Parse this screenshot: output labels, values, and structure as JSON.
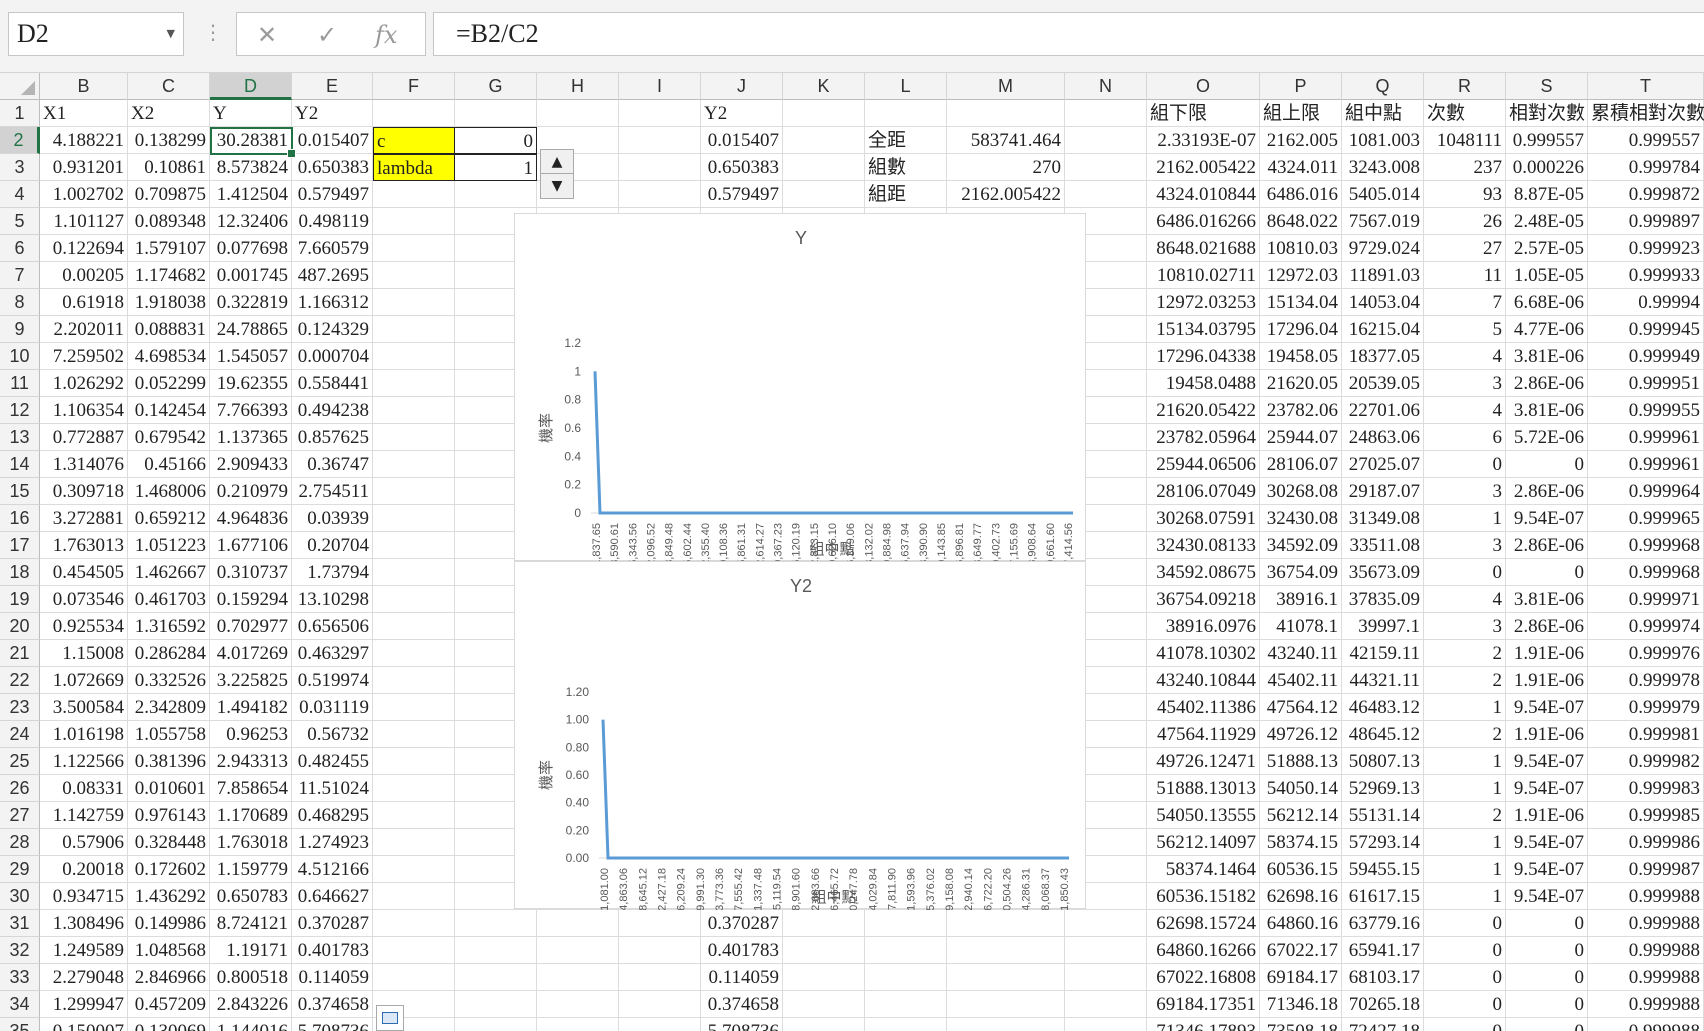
{
  "name_box": "D2",
  "formula": "=B2/C2",
  "icons": {
    "cancel": "✕",
    "enter": "✓",
    "fx": "fx"
  },
  "columns": [
    "B",
    "C",
    "D",
    "E",
    "F",
    "G",
    "H",
    "I",
    "J",
    "K",
    "L",
    "M",
    "N",
    "O",
    "P",
    "Q",
    "R",
    "S",
    "T"
  ],
  "selected_column": "D",
  "rows": [
    1,
    2,
    3,
    4,
    5,
    6,
    7,
    8,
    9,
    10,
    11,
    12,
    13,
    14,
    15,
    16,
    17,
    18,
    19,
    20,
    21,
    22,
    23,
    24,
    25,
    26,
    27,
    28,
    29,
    30,
    31,
    32,
    33,
    34,
    35
  ],
  "selected_row": 2,
  "headers": {
    "B": "X1",
    "C": "X2",
    "D": "Y",
    "E": "Y2",
    "J": "Y2",
    "O": "組下限",
    "P": "組上限",
    "Q": "組中點",
    "R": "次數",
    "S": "相對次數",
    "T": "累積相對次數"
  },
  "colB": [
    "4.188221",
    "0.931201",
    "1.002702",
    "1.101127",
    "0.122694",
    "0.00205",
    "0.61918",
    "2.202011",
    "7.259502",
    "1.026292",
    "1.106354",
    "0.772887",
    "1.314076",
    "0.309718",
    "3.272881",
    "1.763013",
    "0.454505",
    "0.073546",
    "0.925534",
    "1.15008",
    "1.072669",
    "3.500584",
    "1.016198",
    "1.122566",
    "0.08331",
    "1.142759",
    "0.57906",
    "0.20018",
    "0.934715",
    "1.308496",
    "1.249589",
    "2.279048",
    "1.299947",
    "0.150007"
  ],
  "colC": [
    "0.138299",
    "0.10861",
    "0.709875",
    "0.089348",
    "1.579107",
    "1.174682",
    "1.918038",
    "0.088831",
    "4.698534",
    "0.052299",
    "0.142454",
    "0.679542",
    "0.45166",
    "1.468006",
    "0.659212",
    "1.051223",
    "1.462667",
    "0.461703",
    "1.316592",
    "0.286284",
    "0.332526",
    "2.342809",
    "1.055758",
    "0.381396",
    "0.010601",
    "0.976143",
    "0.328448",
    "0.172602",
    "1.436292",
    "0.149986",
    "1.048568",
    "2.846966",
    "0.457209",
    "0.130069"
  ],
  "colD": [
    "30.28381",
    "8.573824",
    "1.412504",
    "12.32406",
    "0.077698",
    "0.001745",
    "0.322819",
    "24.78865",
    "1.545057",
    "19.62355",
    "7.766393",
    "1.137365",
    "2.909433",
    "0.210979",
    "4.964836",
    "1.677106",
    "0.310737",
    "0.159294",
    "0.702977",
    "4.017269",
    "3.225825",
    "1.494182",
    "0.96253",
    "2.943313",
    "7.858654",
    "1.170689",
    "1.763018",
    "1.159779",
    "0.650783",
    "8.724121",
    "1.19171",
    "0.800518",
    "2.843226",
    "1.144016"
  ],
  "colE": [
    "0.015407",
    "0.650383",
    "0.579497",
    "0.498119",
    "7.660579",
    "487.2695",
    "1.166312",
    "0.124329",
    "0.000704",
    "0.558441",
    "0.494238",
    "0.857625",
    "0.36747",
    "2.754511",
    "0.03939",
    "0.20704",
    "1.73794",
    "13.10298",
    "0.656506",
    "0.463297",
    "0.519974",
    "0.031119",
    "0.56732",
    "0.482455",
    "11.51024",
    "0.468295",
    "1.274923",
    "4.512166",
    "0.646627",
    "0.370287",
    "0.401783",
    "0.114059",
    "0.374658",
    "5.708736"
  ],
  "params": {
    "c_label": "c",
    "c_value": "0",
    "lambda_label": "lambda",
    "lambda_value": "1"
  },
  "colJ": {
    "2": "0.015407",
    "3": "0.650383",
    "4": "0.579497",
    "31": "0.370287",
    "32": "0.401783",
    "33": "0.114059",
    "34": "0.374658",
    "35": "5.708736"
  },
  "stats": [
    {
      "label": "全距",
      "value": "583741.464"
    },
    {
      "label": "組數",
      "value": "270"
    },
    {
      "label": "組距",
      "value": "2162.005422"
    }
  ],
  "colO": [
    "2.33193E-07",
    "2162.005422",
    "4324.010844",
    "6486.016266",
    "8648.021688",
    "10810.02711",
    "12972.03253",
    "15134.03795",
    "17296.04338",
    "19458.0488",
    "21620.05422",
    "23782.05964",
    "25944.06506",
    "28106.07049",
    "30268.07591",
    "32430.08133",
    "34592.08675",
    "36754.09218",
    "38916.0976",
    "41078.10302",
    "43240.10844",
    "45402.11386",
    "47564.11929",
    "49726.12471",
    "51888.13013",
    "54050.13555",
    "56212.14097",
    "58374.1464",
    "60536.15182",
    "62698.15724",
    "64860.16266",
    "67022.16808",
    "69184.17351",
    "71346.17893"
  ],
  "colP": [
    "2162.005",
    "4324.011",
    "6486.016",
    "8648.022",
    "10810.03",
    "12972.03",
    "15134.04",
    "17296.04",
    "19458.05",
    "21620.05",
    "23782.06",
    "25944.07",
    "28106.07",
    "30268.08",
    "32430.08",
    "34592.09",
    "36754.09",
    "38916.1",
    "41078.1",
    "43240.11",
    "45402.11",
    "47564.12",
    "49726.12",
    "51888.13",
    "54050.14",
    "56212.14",
    "58374.15",
    "60536.15",
    "62698.16",
    "64860.16",
    "67022.17",
    "69184.17",
    "71346.18",
    "73508.18"
  ],
  "colQ": [
    "1081.003",
    "3243.008",
    "5405.014",
    "7567.019",
    "9729.024",
    "11891.03",
    "14053.04",
    "16215.04",
    "18377.05",
    "20539.05",
    "22701.06",
    "24863.06",
    "27025.07",
    "29187.07",
    "31349.08",
    "33511.08",
    "35673.09",
    "37835.09",
    "39997.1",
    "42159.11",
    "44321.11",
    "46483.12",
    "48645.12",
    "50807.13",
    "52969.13",
    "55131.14",
    "57293.14",
    "59455.15",
    "61617.15",
    "63779.16",
    "65941.17",
    "68103.17",
    "70265.18",
    "72427.18"
  ],
  "colR": [
    "1048111",
    "237",
    "93",
    "26",
    "27",
    "11",
    "7",
    "5",
    "4",
    "3",
    "4",
    "6",
    "0",
    "3",
    "1",
    "3",
    "0",
    "4",
    "3",
    "2",
    "2",
    "1",
    "2",
    "1",
    "1",
    "2",
    "1",
    "1",
    "1",
    "0",
    "0",
    "0",
    "0",
    "0"
  ],
  "colS": [
    "0.999557",
    "0.000226",
    "8.87E-05",
    "2.48E-05",
    "2.57E-05",
    "1.05E-05",
    "6.68E-06",
    "4.77E-06",
    "3.81E-06",
    "2.86E-06",
    "3.81E-06",
    "5.72E-06",
    "0",
    "2.86E-06",
    "9.54E-07",
    "2.86E-06",
    "0",
    "3.81E-06",
    "2.86E-06",
    "1.91E-06",
    "1.91E-06",
    "9.54E-07",
    "1.91E-06",
    "9.54E-07",
    "9.54E-07",
    "1.91E-06",
    "9.54E-07",
    "9.54E-07",
    "9.54E-07",
    "0",
    "0",
    "0",
    "0",
    "0"
  ],
  "colT": [
    "0.999557",
    "0.999784",
    "0.999872",
    "0.999897",
    "0.999923",
    "0.999933",
    "0.99994",
    "0.999945",
    "0.999949",
    "0.999951",
    "0.999955",
    "0.999961",
    "0.999961",
    "0.999964",
    "0.999965",
    "0.999968",
    "0.999968",
    "0.999971",
    "0.999974",
    "0.999976",
    "0.999978",
    "0.999979",
    "0.999981",
    "0.999982",
    "0.999983",
    "0.999985",
    "0.999986",
    "0.999987",
    "0.999988",
    "0.999988",
    "0.999988",
    "0.999988",
    "0.999988",
    "0.999988"
  ],
  "chart_data": [
    {
      "type": "line",
      "title": "Y",
      "xlabel": "組中點",
      "ylabel": "機率",
      "yticks": [
        "0",
        "0.2",
        "0.4",
        "0.6",
        "0.8",
        "1",
        "1.2"
      ],
      "ylim": [
        0,
        1.2
      ],
      "categories": [
        "1,837.65",
        "38,590.61",
        "75,343.56",
        "112,096.52",
        "148,849.48",
        "185,602.44",
        "222,355.40",
        "259,108.36",
        "295,861.31",
        "332,614.27",
        "369,367.23",
        "406,120.19",
        "442,873.15",
        "479,626.10",
        "516,379.06",
        "553,132.02",
        "589,884.98",
        "626,637.94",
        "663,390.90",
        "700,143.85",
        "736,896.81",
        "773,649.77",
        "810,402.73",
        "847,155.69",
        "883,908.64",
        "920,661.60",
        "957,414.56"
      ],
      "series": [
        {
          "values": [
            1,
            0,
            0,
            0,
            0,
            0,
            0,
            0,
            0,
            0,
            0,
            0,
            0,
            0,
            0,
            0,
            0,
            0,
            0,
            0,
            0,
            0,
            0,
            0,
            0,
            0,
            0
          ]
        }
      ],
      "color": "#5b9bd5"
    },
    {
      "type": "line",
      "title": "Y2",
      "xlabel": "組中點",
      "ylabel": "機率",
      "yticks": [
        "0.00",
        "0.20",
        "0.40",
        "0.60",
        "0.80",
        "1.00",
        "1.20"
      ],
      "ylim": [
        0,
        1.2
      ],
      "categories": [
        "1,081.00",
        "24,863.06",
        "48,645.12",
        "72,427.18",
        "96,209.24",
        "119,991.30",
        "143,773.36",
        "167,555.42",
        "191,337.48",
        "215,119.54",
        "238,901.60",
        "262,683.66",
        "286,465.72",
        "310,247.78",
        "334,029.84",
        "357,811.90",
        "381,593.96",
        "405,376.02",
        "429,158.08",
        "452,940.14",
        "476,722.20",
        "500,504.26",
        "524,286.31",
        "548,068.37",
        "571,850.43"
      ],
      "series": [
        {
          "values": [
            1,
            0,
            0,
            0,
            0,
            0,
            0,
            0,
            0,
            0,
            0,
            0,
            0,
            0,
            0,
            0,
            0,
            0,
            0,
            0,
            0,
            0,
            0,
            0,
            0
          ]
        }
      ],
      "color": "#5b9bd5"
    }
  ]
}
